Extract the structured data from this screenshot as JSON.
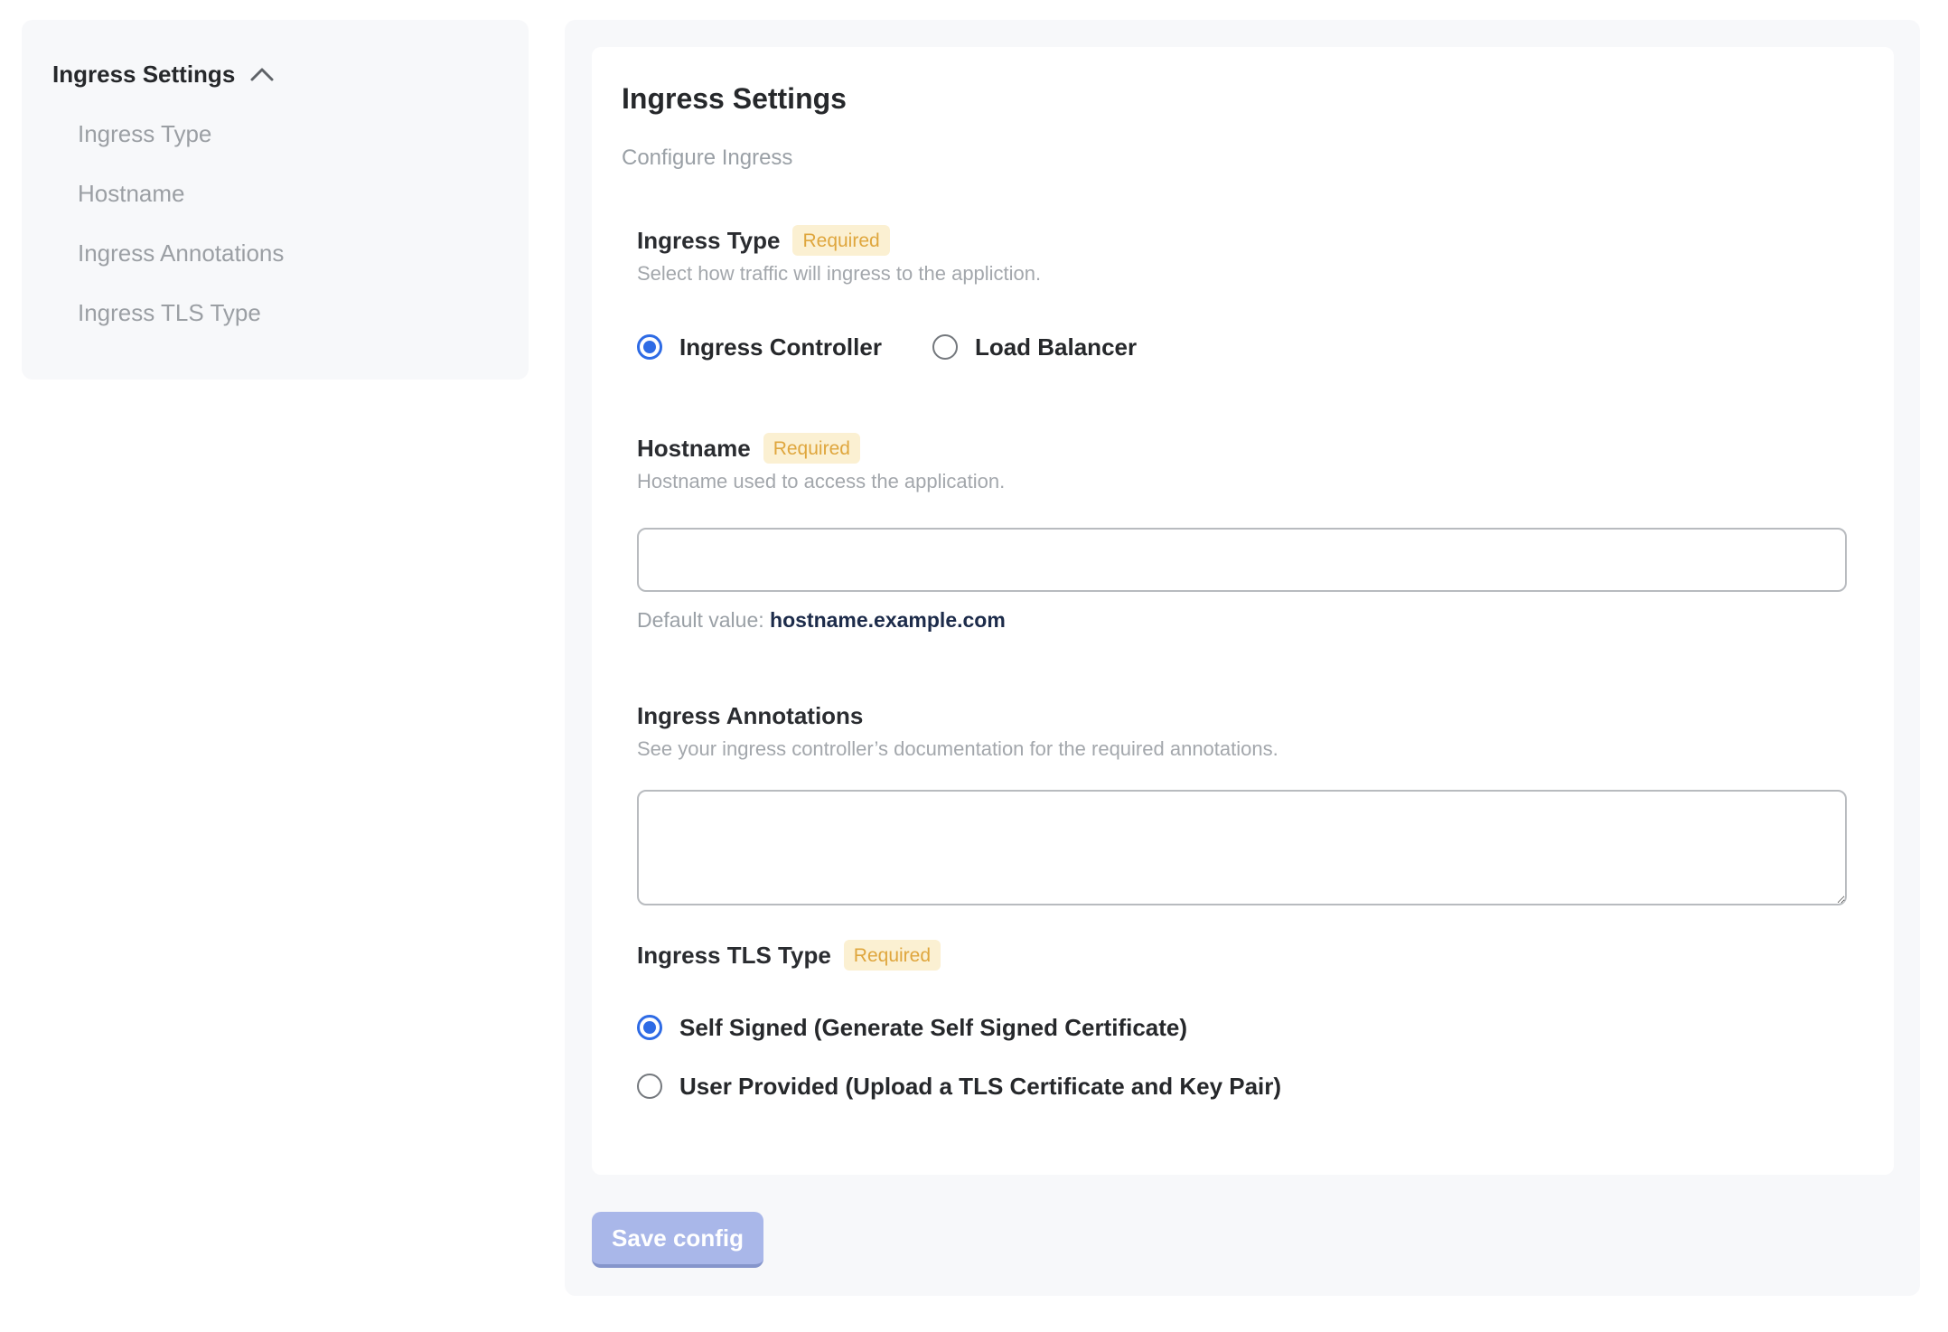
{
  "colors": {
    "panel_background": "#f7f8fa",
    "card_background": "#ffffff",
    "accent_blue": "#2e6be5",
    "badge_background": "#fbf0d2",
    "badge_text": "#dfa63d",
    "muted_text": "#9aa0a6",
    "dark_text": "#26282b",
    "default_value_text": "#1c2b4a",
    "save_button_background": "#a9b7e9"
  },
  "sidebar": {
    "title": "Ingress Settings",
    "collapse_icon": "chevron-up-icon",
    "items": [
      {
        "label": "Ingress Type"
      },
      {
        "label": "Hostname"
      },
      {
        "label": "Ingress Annotations"
      },
      {
        "label": "Ingress TLS Type"
      }
    ]
  },
  "main": {
    "title": "Ingress Settings",
    "subtitle": "Configure Ingress",
    "sections": {
      "ingress_type": {
        "label": "Ingress Type",
        "required_badge": "Required",
        "helper": "Select how traffic will ingress to the appliction.",
        "options": [
          {
            "label": "Ingress Controller",
            "selected": true
          },
          {
            "label": "Load Balancer",
            "selected": false
          }
        ]
      },
      "hostname": {
        "label": "Hostname",
        "required_badge": "Required",
        "helper": "Hostname used to access the application.",
        "value": "",
        "placeholder": "",
        "default_prefix": "Default value: ",
        "default_value": "hostname.example.com"
      },
      "annotations": {
        "label": "Ingress Annotations",
        "helper": "See your ingress controller’s documentation for the required annotations.",
        "value": ""
      },
      "tls": {
        "label": "Ingress TLS Type",
        "required_badge": "Required",
        "options": [
          {
            "label": "Self Signed (Generate Self Signed Certificate)",
            "selected": true
          },
          {
            "label": "User Provided (Upload a TLS Certificate and Key Pair)",
            "selected": false
          }
        ]
      }
    },
    "save_button_label": "Save config"
  }
}
